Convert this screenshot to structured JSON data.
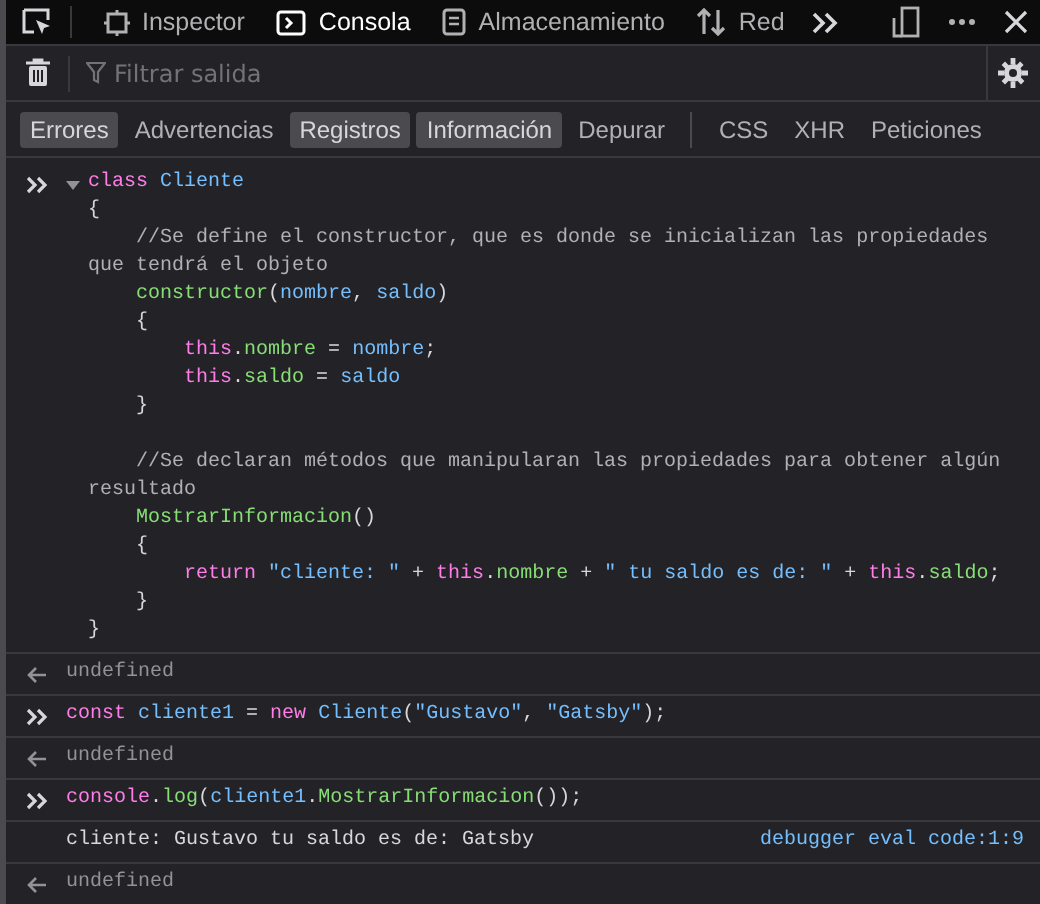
{
  "toolbar": {
    "tabs": [
      {
        "label": "Inspector",
        "selected": false
      },
      {
        "label": "Consola",
        "selected": true
      },
      {
        "label": "Almacenamiento",
        "selected": false
      },
      {
        "label": "Red",
        "selected": false
      }
    ]
  },
  "filter": {
    "placeholder": "Filtrar salida"
  },
  "levels": [
    {
      "label": "Errores",
      "selected": true
    },
    {
      "label": "Advertencias",
      "selected": false
    },
    {
      "label": "Registros",
      "selected": true
    },
    {
      "label": "Información",
      "selected": true
    },
    {
      "label": "Depurar",
      "selected": false
    }
  ],
  "types": [
    {
      "label": "CSS",
      "selected": false
    },
    {
      "label": "XHR",
      "selected": false
    },
    {
      "label": "Peticiones",
      "selected": false
    }
  ],
  "messages": [
    {
      "kind": "input",
      "expanded": true,
      "lines": [
        {
          "tokens": [
            {
              "t": "class ",
              "kind": "keyword"
            },
            {
              "t": "Cliente",
              "kind": "ident"
            }
          ]
        },
        {
          "tokens": [
            {
              "t": "{",
              "kind": "plain"
            }
          ]
        },
        {
          "tokens": [
            {
              "t": "    //Se define el constructor, que es donde se inicializan las propiedades",
              "kind": "comment"
            }
          ]
        },
        {
          "tokens": [
            {
              "t": "que tendrá el objeto",
              "kind": "comment"
            }
          ]
        },
        {
          "tokens": [
            {
              "t": "    constructor",
              "kind": "func"
            },
            {
              "t": "(",
              "kind": "plain"
            },
            {
              "t": "nombre",
              "kind": "ident"
            },
            {
              "t": ", ",
              "kind": "plain"
            },
            {
              "t": "saldo",
              "kind": "ident"
            },
            {
              "t": ")",
              "kind": "plain"
            }
          ]
        },
        {
          "tokens": [
            {
              "t": "    {",
              "kind": "plain"
            }
          ]
        },
        {
          "tokens": [
            {
              "t": "        this",
              "kind": "keyword"
            },
            {
              "t": ".",
              "kind": "plain"
            },
            {
              "t": "nombre",
              "kind": "func"
            },
            {
              "t": " = ",
              "kind": "plain"
            },
            {
              "t": "nombre",
              "kind": "ident"
            },
            {
              "t": ";",
              "kind": "plain"
            }
          ]
        },
        {
          "tokens": [
            {
              "t": "        this",
              "kind": "keyword"
            },
            {
              "t": ".",
              "kind": "plain"
            },
            {
              "t": "saldo",
              "kind": "func"
            },
            {
              "t": " = ",
              "kind": "plain"
            },
            {
              "t": "saldo",
              "kind": "ident"
            }
          ]
        },
        {
          "tokens": [
            {
              "t": "    }",
              "kind": "plain"
            }
          ]
        },
        {
          "spaced": true,
          "tokens": [
            {
              "t": "    //Se declaran métodos que manipularan las propiedades para obtener algún",
              "kind": "comment"
            }
          ]
        },
        {
          "tokens": [
            {
              "t": "resultado",
              "kind": "comment"
            }
          ]
        },
        {
          "tokens": [
            {
              "t": "    MostrarInformacion",
              "kind": "func"
            },
            {
              "t": "()",
              "kind": "plain"
            }
          ]
        },
        {
          "tokens": [
            {
              "t": "    {",
              "kind": "plain"
            }
          ]
        },
        {
          "tokens": [
            {
              "t": "        return ",
              "kind": "keyword"
            },
            {
              "t": "\"cliente: \"",
              "kind": "string"
            },
            {
              "t": " + ",
              "kind": "plain"
            },
            {
              "t": "this",
              "kind": "keyword"
            },
            {
              "t": ".",
              "kind": "plain"
            },
            {
              "t": "nombre",
              "kind": "func"
            },
            {
              "t": " + ",
              "kind": "plain"
            },
            {
              "t": "\" tu saldo es de: \"",
              "kind": "string"
            },
            {
              "t": " + ",
              "kind": "plain"
            },
            {
              "t": "this",
              "kind": "keyword"
            },
            {
              "t": ".",
              "kind": "plain"
            },
            {
              "t": "saldo",
              "kind": "func"
            },
            {
              "t": ";",
              "kind": "plain"
            }
          ]
        },
        {
          "tokens": [
            {
              "t": "    }",
              "kind": "plain"
            }
          ]
        },
        {
          "tokens": [
            {
              "t": "}",
              "kind": "plain"
            }
          ]
        }
      ]
    },
    {
      "kind": "result",
      "text": "undefined"
    },
    {
      "kind": "input",
      "lines": [
        {
          "tokens": [
            {
              "t": "const ",
              "kind": "keyword"
            },
            {
              "t": "cliente1",
              "kind": "ident"
            },
            {
              "t": " = ",
              "kind": "plain"
            },
            {
              "t": "new ",
              "kind": "keyword"
            },
            {
              "t": "Cliente",
              "kind": "ident"
            },
            {
              "t": "(",
              "kind": "plain"
            },
            {
              "t": "\"Gustavo\"",
              "kind": "string"
            },
            {
              "t": ", ",
              "kind": "plain"
            },
            {
              "t": "\"Gatsby\"",
              "kind": "string"
            },
            {
              "t": ");",
              "kind": "plain"
            }
          ]
        }
      ]
    },
    {
      "kind": "result",
      "text": "undefined"
    },
    {
      "kind": "input",
      "lines": [
        {
          "tokens": [
            {
              "t": "console",
              "kind": "keyword"
            },
            {
              "t": ".",
              "kind": "plain"
            },
            {
              "t": "log",
              "kind": "func"
            },
            {
              "t": "(",
              "kind": "plain"
            },
            {
              "t": "cliente1",
              "kind": "ident"
            },
            {
              "t": ".",
              "kind": "plain"
            },
            {
              "t": "MostrarInformacion",
              "kind": "func"
            },
            {
              "t": "());",
              "kind": "plain"
            }
          ]
        }
      ]
    },
    {
      "kind": "log",
      "text": "cliente: Gustavo tu saldo es de: Gatsby",
      "source": "debugger eval code:1:9"
    },
    {
      "kind": "result",
      "text": "undefined"
    }
  ]
}
